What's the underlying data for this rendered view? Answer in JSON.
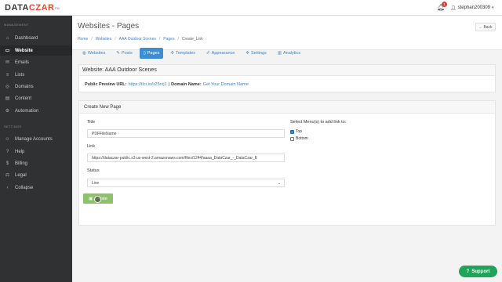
{
  "app": {
    "logo_text_a": "DATA",
    "logo_text_b": "CZAR",
    "logo_mark": "TM"
  },
  "topbar": {
    "notification_count": "1",
    "username": "stephan200309"
  },
  "sidebar": {
    "section_main": "MANAGEMENT",
    "section_settings": "SETTINGS",
    "items": [
      {
        "label": "Dashboard",
        "icon": "dashboard-icon"
      },
      {
        "label": "Website",
        "icon": "website-icon"
      },
      {
        "label": "Emails",
        "icon": "mail-icon"
      },
      {
        "label": "Lists",
        "icon": "list-icon"
      },
      {
        "label": "Domains",
        "icon": "globe-icon"
      },
      {
        "label": "Content",
        "icon": "document-icon"
      },
      {
        "label": "Automation",
        "icon": "automation-icon"
      },
      {
        "label": "Manage Accounts",
        "icon": "users-icon"
      },
      {
        "label": "Help",
        "icon": "help-icon"
      },
      {
        "label": "Billing",
        "icon": "dollar-icon"
      },
      {
        "label": "Legal",
        "icon": "legal-icon"
      },
      {
        "label": "Collapse",
        "icon": "chevron-left-icon"
      }
    ]
  },
  "header": {
    "title": "Websites - Pages",
    "back_label": "Back",
    "breadcrumb": [
      "Home",
      "Websites",
      "AAA Outdoor Scenes",
      "Pages",
      "Create_Link"
    ]
  },
  "tabs": [
    {
      "label": "Websites",
      "icon": "globe-icon"
    },
    {
      "label": "Posts",
      "icon": "edit-icon"
    },
    {
      "label": "Pages",
      "icon": "pages-icon"
    },
    {
      "label": "Templates",
      "icon": "puzzle-icon"
    },
    {
      "label": "Appearance",
      "icon": "brush-icon"
    },
    {
      "label": "Settings",
      "icon": "gear-icon"
    },
    {
      "label": "Analytics",
      "icon": "bar-chart-icon"
    }
  ],
  "website_panel": {
    "title": "Website: AAA Outdoor Scenes",
    "preview_label": "Public Preview URL:",
    "preview_url": "https://tlcr.io/lr25nrj1",
    "separator": "|",
    "domain_label": "Domain Name:",
    "domain_link": "Get Your Domain Name"
  },
  "form": {
    "panel_title": "Create New Page",
    "title_label": "Title",
    "title_value": "PDFFileName",
    "link_label": "Link",
    "link_value": "https://dataczar-public.s3.us-west-2.amazonaws.com/files/1244/aaaa_DataCzar_-_DataCzar_E",
    "status_label": "Status",
    "status_value": "Live",
    "menus_label": "Select Menu(s) to add link to:",
    "menu_options": [
      {
        "label": "Top",
        "checked": true
      },
      {
        "label": "Bottom",
        "checked": false
      }
    ],
    "submit_label": "Create"
  },
  "support": {
    "label": "Support"
  },
  "colors": {
    "accent": "#3b8ed2",
    "sidebar": "#2f3133",
    "brand": "#e8482c",
    "success": "#8cc26a",
    "support": "#22a35a"
  }
}
